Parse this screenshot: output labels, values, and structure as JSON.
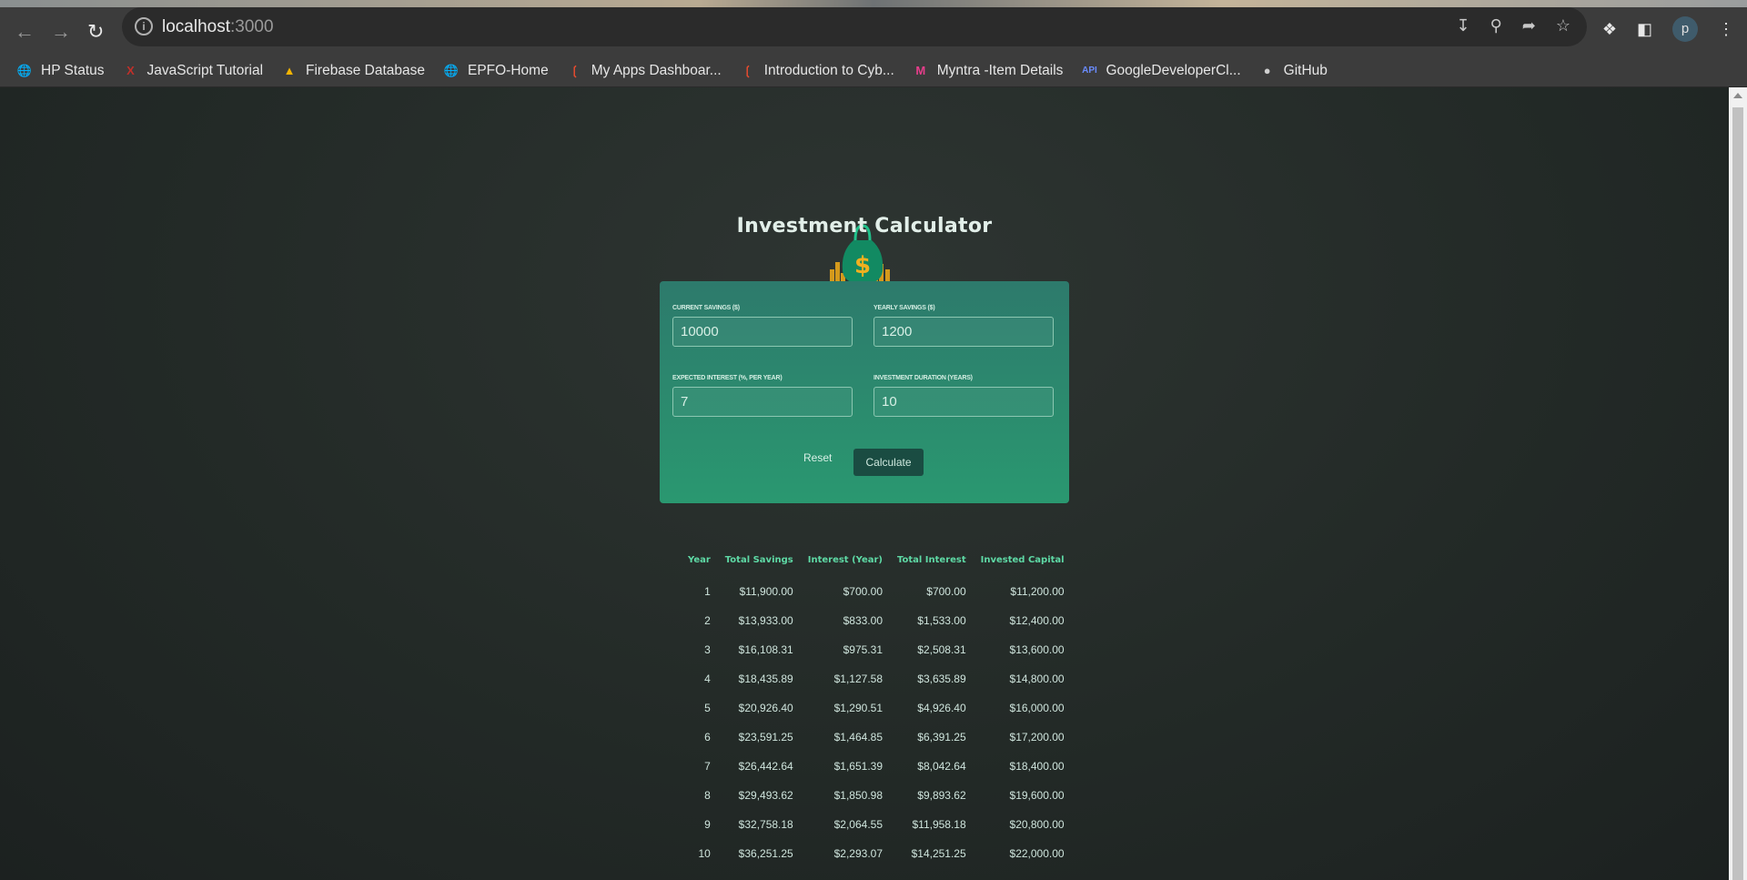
{
  "browser": {
    "url_host": "localhost",
    "url_port": ":3000",
    "avatar_letter": "p",
    "bookmarks": [
      {
        "label": "HP Status",
        "icon": "globe-icon"
      },
      {
        "label": "JavaScript Tutorial",
        "icon": "javascript-tutorial-icon"
      },
      {
        "label": "Firebase Database",
        "icon": "firebase-icon"
      },
      {
        "label": "EPFO-Home",
        "icon": "globe-icon"
      },
      {
        "label": "My Apps Dashboar...",
        "icon": "apps-dashboard-icon"
      },
      {
        "label": "Introduction to Cyb...",
        "icon": "apps-dashboard-icon"
      },
      {
        "label": "Myntra -Item Details",
        "icon": "myntra-icon"
      },
      {
        "label": "GoogleDeveloperCl...",
        "icon": "api-icon"
      },
      {
        "label": "GitHub",
        "icon": "github-icon"
      }
    ]
  },
  "header": {
    "title": "Investment Calculator",
    "logo": "money-bag-icon"
  },
  "form": {
    "current_savings": {
      "label": "Current Savings ($)",
      "value": "10000"
    },
    "yearly_savings": {
      "label": "Yearly Savings ($)",
      "value": "1200"
    },
    "expected_interest": {
      "label": "Expected Interest (%, per year)",
      "value": "7"
    },
    "duration": {
      "label": "Investment Duration (years)",
      "value": "10"
    },
    "reset_label": "Reset",
    "calculate_label": "Calculate"
  },
  "results": {
    "headers": [
      "Year",
      "Total Savings",
      "Interest (Year)",
      "Total Interest",
      "Invested Capital"
    ],
    "rows": [
      [
        "1",
        "$11,900.00",
        "$700.00",
        "$700.00",
        "$11,200.00"
      ],
      [
        "2",
        "$13,933.00",
        "$833.00",
        "$1,533.00",
        "$12,400.00"
      ],
      [
        "3",
        "$16,108.31",
        "$975.31",
        "$2,508.31",
        "$13,600.00"
      ],
      [
        "4",
        "$18,435.89",
        "$1,127.58",
        "$3,635.89",
        "$14,800.00"
      ],
      [
        "5",
        "$20,926.40",
        "$1,290.51",
        "$4,926.40",
        "$16,000.00"
      ],
      [
        "6",
        "$23,591.25",
        "$1,464.85",
        "$6,391.25",
        "$17,200.00"
      ],
      [
        "7",
        "$26,442.64",
        "$1,651.39",
        "$8,042.64",
        "$18,400.00"
      ],
      [
        "8",
        "$29,493.62",
        "$1,850.98",
        "$9,893.62",
        "$19,600.00"
      ],
      [
        "9",
        "$32,758.18",
        "$2,064.55",
        "$11,958.18",
        "$20,800.00"
      ],
      [
        "10",
        "$36,251.25",
        "$2,293.07",
        "$14,251.25",
        "$22,000.00"
      ]
    ]
  },
  "colors": {
    "accent": "#5ed9a5",
    "panel_top": "#2d7a6c",
    "panel_bottom": "#2a9870",
    "button": "#1a4c42",
    "background": "#232a27"
  }
}
